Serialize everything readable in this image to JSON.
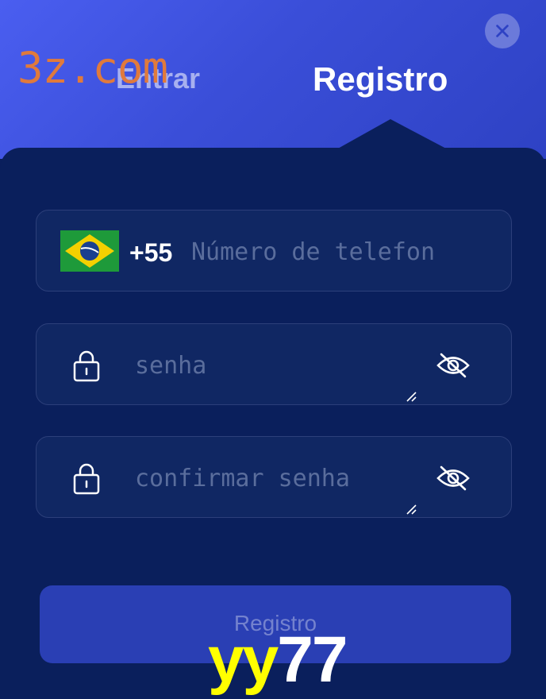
{
  "header": {
    "tabs": [
      {
        "label": "Entrar",
        "active": false
      },
      {
        "label": "Registro",
        "active": true
      }
    ],
    "close_icon": "close-icon"
  },
  "watermarks": {
    "top": "3z.com",
    "bottom_part1": "yy",
    "bottom_part2": "77"
  },
  "form": {
    "phone": {
      "country_flag": "brazil-flag-icon",
      "prefix": "+55",
      "placeholder": "Número de telefon",
      "value": ""
    },
    "password": {
      "placeholder": "senha",
      "value": "",
      "lock_icon": "lock-icon",
      "visibility_icon": "eye-slash-icon"
    },
    "confirm_password": {
      "placeholder": "confirmar senha",
      "value": "",
      "lock_icon": "lock-icon",
      "visibility_icon": "eye-slash-icon"
    },
    "submit_label": "Registro"
  },
  "colors": {
    "header_gradient_start": "#4a5ef0",
    "panel_background": "#0a1f5c",
    "field_background": "#102763",
    "field_border": "#2c3f7a",
    "button_background": "#2a3fb4",
    "watermark_top": "#e07a3c",
    "watermark_yellow": "#ffff00"
  }
}
